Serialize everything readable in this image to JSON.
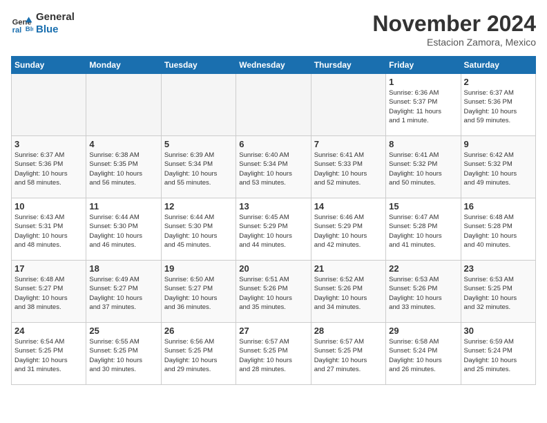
{
  "header": {
    "logo_line1": "General",
    "logo_line2": "Blue",
    "month": "November 2024",
    "location": "Estacion Zamora, Mexico"
  },
  "weekdays": [
    "Sunday",
    "Monday",
    "Tuesday",
    "Wednesday",
    "Thursday",
    "Friday",
    "Saturday"
  ],
  "weeks": [
    [
      {
        "day": "",
        "info": ""
      },
      {
        "day": "",
        "info": ""
      },
      {
        "day": "",
        "info": ""
      },
      {
        "day": "",
        "info": ""
      },
      {
        "day": "",
        "info": ""
      },
      {
        "day": "1",
        "info": "Sunrise: 6:36 AM\nSunset: 5:37 PM\nDaylight: 11 hours\nand 1 minute."
      },
      {
        "day": "2",
        "info": "Sunrise: 6:37 AM\nSunset: 5:36 PM\nDaylight: 10 hours\nand 59 minutes."
      }
    ],
    [
      {
        "day": "3",
        "info": "Sunrise: 6:37 AM\nSunset: 5:36 PM\nDaylight: 10 hours\nand 58 minutes."
      },
      {
        "day": "4",
        "info": "Sunrise: 6:38 AM\nSunset: 5:35 PM\nDaylight: 10 hours\nand 56 minutes."
      },
      {
        "day": "5",
        "info": "Sunrise: 6:39 AM\nSunset: 5:34 PM\nDaylight: 10 hours\nand 55 minutes."
      },
      {
        "day": "6",
        "info": "Sunrise: 6:40 AM\nSunset: 5:34 PM\nDaylight: 10 hours\nand 53 minutes."
      },
      {
        "day": "7",
        "info": "Sunrise: 6:41 AM\nSunset: 5:33 PM\nDaylight: 10 hours\nand 52 minutes."
      },
      {
        "day": "8",
        "info": "Sunrise: 6:41 AM\nSunset: 5:32 PM\nDaylight: 10 hours\nand 50 minutes."
      },
      {
        "day": "9",
        "info": "Sunrise: 6:42 AM\nSunset: 5:32 PM\nDaylight: 10 hours\nand 49 minutes."
      }
    ],
    [
      {
        "day": "10",
        "info": "Sunrise: 6:43 AM\nSunset: 5:31 PM\nDaylight: 10 hours\nand 48 minutes."
      },
      {
        "day": "11",
        "info": "Sunrise: 6:44 AM\nSunset: 5:30 PM\nDaylight: 10 hours\nand 46 minutes."
      },
      {
        "day": "12",
        "info": "Sunrise: 6:44 AM\nSunset: 5:30 PM\nDaylight: 10 hours\nand 45 minutes."
      },
      {
        "day": "13",
        "info": "Sunrise: 6:45 AM\nSunset: 5:29 PM\nDaylight: 10 hours\nand 44 minutes."
      },
      {
        "day": "14",
        "info": "Sunrise: 6:46 AM\nSunset: 5:29 PM\nDaylight: 10 hours\nand 42 minutes."
      },
      {
        "day": "15",
        "info": "Sunrise: 6:47 AM\nSunset: 5:28 PM\nDaylight: 10 hours\nand 41 minutes."
      },
      {
        "day": "16",
        "info": "Sunrise: 6:48 AM\nSunset: 5:28 PM\nDaylight: 10 hours\nand 40 minutes."
      }
    ],
    [
      {
        "day": "17",
        "info": "Sunrise: 6:48 AM\nSunset: 5:27 PM\nDaylight: 10 hours\nand 38 minutes."
      },
      {
        "day": "18",
        "info": "Sunrise: 6:49 AM\nSunset: 5:27 PM\nDaylight: 10 hours\nand 37 minutes."
      },
      {
        "day": "19",
        "info": "Sunrise: 6:50 AM\nSunset: 5:27 PM\nDaylight: 10 hours\nand 36 minutes."
      },
      {
        "day": "20",
        "info": "Sunrise: 6:51 AM\nSunset: 5:26 PM\nDaylight: 10 hours\nand 35 minutes."
      },
      {
        "day": "21",
        "info": "Sunrise: 6:52 AM\nSunset: 5:26 PM\nDaylight: 10 hours\nand 34 minutes."
      },
      {
        "day": "22",
        "info": "Sunrise: 6:53 AM\nSunset: 5:26 PM\nDaylight: 10 hours\nand 33 minutes."
      },
      {
        "day": "23",
        "info": "Sunrise: 6:53 AM\nSunset: 5:25 PM\nDaylight: 10 hours\nand 32 minutes."
      }
    ],
    [
      {
        "day": "24",
        "info": "Sunrise: 6:54 AM\nSunset: 5:25 PM\nDaylight: 10 hours\nand 31 minutes."
      },
      {
        "day": "25",
        "info": "Sunrise: 6:55 AM\nSunset: 5:25 PM\nDaylight: 10 hours\nand 30 minutes."
      },
      {
        "day": "26",
        "info": "Sunrise: 6:56 AM\nSunset: 5:25 PM\nDaylight: 10 hours\nand 29 minutes."
      },
      {
        "day": "27",
        "info": "Sunrise: 6:57 AM\nSunset: 5:25 PM\nDaylight: 10 hours\nand 28 minutes."
      },
      {
        "day": "28",
        "info": "Sunrise: 6:57 AM\nSunset: 5:25 PM\nDaylight: 10 hours\nand 27 minutes."
      },
      {
        "day": "29",
        "info": "Sunrise: 6:58 AM\nSunset: 5:24 PM\nDaylight: 10 hours\nand 26 minutes."
      },
      {
        "day": "30",
        "info": "Sunrise: 6:59 AM\nSunset: 5:24 PM\nDaylight: 10 hours\nand 25 minutes."
      }
    ]
  ]
}
